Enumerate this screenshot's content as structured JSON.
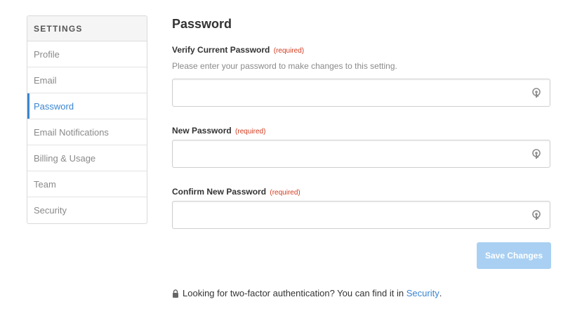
{
  "sidebar": {
    "header": "SETTINGS",
    "items": [
      {
        "label": "Profile"
      },
      {
        "label": "Email"
      },
      {
        "label": "Password"
      },
      {
        "label": "Email Notifications"
      },
      {
        "label": "Billing & Usage"
      },
      {
        "label": "Team"
      },
      {
        "label": "Security"
      }
    ],
    "active_index": 2
  },
  "main": {
    "title": "Password",
    "fields": [
      {
        "label": "Verify Current Password",
        "required": "(required)",
        "help": "Please enter your password to make changes to this setting.",
        "value": ""
      },
      {
        "label": "New Password",
        "required": "(required)",
        "value": ""
      },
      {
        "label": "Confirm New Password",
        "required": "(required)",
        "value": ""
      }
    ],
    "save_label": "Save Changes",
    "footer": {
      "text": "Looking for two-factor authentication? You can find it in",
      "link": "Security",
      "end": "."
    }
  },
  "colors": {
    "accent": "#3a85d1",
    "required": "#d13b1f",
    "button_disabled": "#a9d0f2"
  },
  "icons": [
    "key-icon",
    "lock-icon"
  ]
}
